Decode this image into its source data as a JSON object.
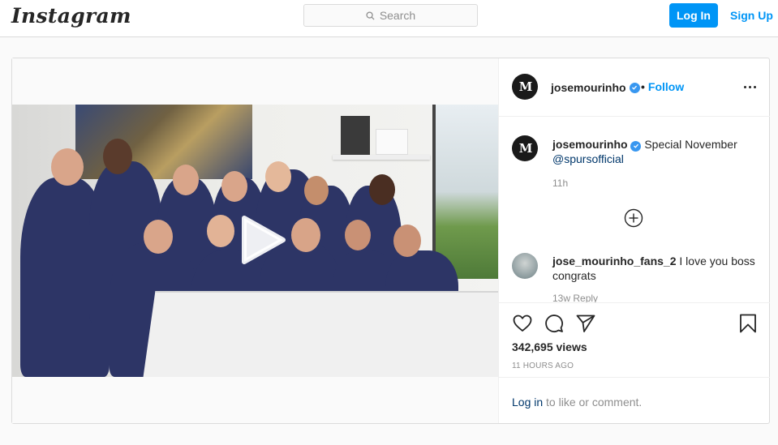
{
  "nav": {
    "logo": "Instagram",
    "search_placeholder": "Search",
    "login_label": "Log In",
    "signup_label": "Sign Up"
  },
  "post": {
    "author": "josemourinho",
    "author_avatar_initials": "M",
    "follow_label": "Follow",
    "separator": "•",
    "caption_text": "Special November",
    "caption_mention": "@spursofficial",
    "caption_time": "11h",
    "comments": [
      {
        "username": "jose_mourinho_fans_2",
        "text": "I love you boss congrats",
        "meta": "13w   Reply"
      }
    ],
    "views": "342,695 views",
    "time_ago": "11 HOURS AGO",
    "login_prompt_link": "Log in",
    "login_prompt_rest": "to like or comment."
  },
  "icons": {
    "search": "search-icon",
    "verified": "verified-badge-icon",
    "more": "more-options-icon",
    "play": "play-icon",
    "load_more": "load-more-comments-icon",
    "like": "heart-icon",
    "comment": "comment-icon",
    "share": "share-icon",
    "save": "bookmark-icon"
  },
  "colors": {
    "accent": "#0095f6",
    "verified": "#3897f0",
    "link_dark": "#00376b",
    "text": "#262626",
    "muted": "#8e8e8e"
  }
}
